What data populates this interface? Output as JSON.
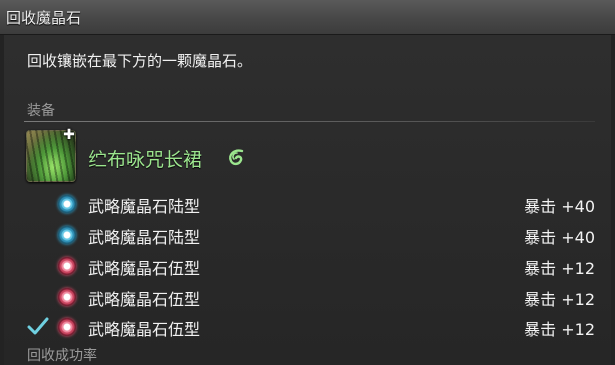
{
  "window": {
    "title": "回收魔晶石"
  },
  "description": "回收镶嵌在最下方的一颗魔晶石。",
  "equipment_section": {
    "label": "装备",
    "item": {
      "name": "纻布咏咒长裙",
      "icon": "robe-item-icon",
      "quality": "hq-icon",
      "badge": "add-plus-icon"
    }
  },
  "materia": [
    {
      "name": "武略魔晶石陆型",
      "stat": "暴击 +40",
      "color": "blue",
      "selected": false
    },
    {
      "name": "武略魔晶石陆型",
      "stat": "暴击 +40",
      "color": "blue",
      "selected": false
    },
    {
      "name": "武略魔晶石伍型",
      "stat": "暴击 +12",
      "color": "red",
      "selected": false
    },
    {
      "name": "武略魔晶石伍型",
      "stat": "暴击 +12",
      "color": "red",
      "selected": false
    },
    {
      "name": "武略魔晶石伍型",
      "stat": "暴击 +12",
      "color": "red",
      "selected": true
    }
  ],
  "success_section": {
    "label": "回收成功率"
  },
  "colors": {
    "item_name": "#9ce68e",
    "check": "#6fd0e0",
    "materia_blue": "#2f8fb5",
    "materia_red": "#c8445f"
  }
}
